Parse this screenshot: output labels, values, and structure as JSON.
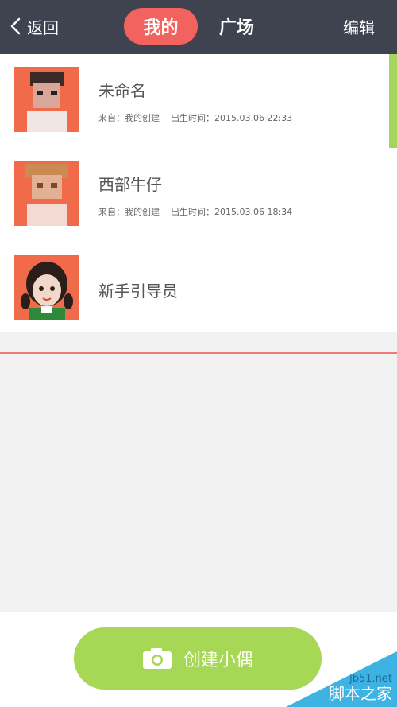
{
  "header": {
    "back_label": "返回",
    "tabs": [
      {
        "label": "我的",
        "active": true
      },
      {
        "label": "广场",
        "active": false
      }
    ],
    "edit_label": "编辑"
  },
  "list": {
    "items": [
      {
        "name": "未命名",
        "source": "来自：我的创建",
        "birth": "出生时间：2015.03.06 22:33"
      },
      {
        "name": "西部牛仔",
        "source": "来自：我的创建",
        "birth": "出生时间：2015.03.06 18:34"
      },
      {
        "name": "新手引导员"
      }
    ]
  },
  "footer": {
    "create_label": "创建小偶"
  },
  "watermark": {
    "site": "jb51.net",
    "name": "脚本之家"
  },
  "colors": {
    "header_bg": "#3f4350",
    "active_tab": "#f2625f",
    "accent_green": "#a6d755",
    "divider": "#ef7a73"
  }
}
